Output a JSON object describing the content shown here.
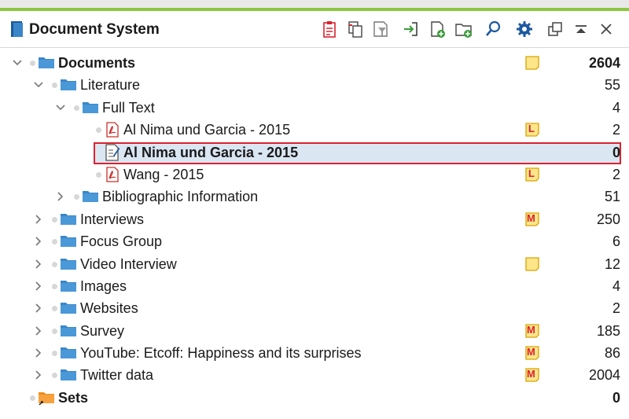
{
  "header": {
    "title": "Document System",
    "icons": [
      "import-documents-icon",
      "copy-documents-icon",
      "filter-icon",
      "import-arrow-icon",
      "new-document-icon",
      "new-folder-icon",
      "search-icon",
      "settings-icon",
      "undock-window-icon",
      "collapse-panel-icon",
      "close-icon"
    ]
  },
  "tree": {
    "root": {
      "label": "Documents",
      "count": "2604"
    },
    "literature": {
      "label": "Literature",
      "count": "55"
    },
    "fulltext": {
      "label": "Full Text",
      "count": "4"
    },
    "doc1": {
      "label": "Al Nima und Garcia - 2015",
      "count": "2",
      "memo": "L"
    },
    "doc2": {
      "label": "Al Nima und Garcia - 2015",
      "count": "0"
    },
    "doc3": {
      "label": "Wang - 2015",
      "count": "2",
      "memo": "L"
    },
    "biblio": {
      "label": "Bibliographic Information",
      "count": "51"
    },
    "interviews": {
      "label": "Interviews",
      "count": "250",
      "memo": "M"
    },
    "focus": {
      "label": "Focus Group",
      "count": "6"
    },
    "video": {
      "label": "Video Interview",
      "count": "12"
    },
    "images": {
      "label": "Images",
      "count": "4"
    },
    "websites": {
      "label": "Websites",
      "count": "2"
    },
    "survey": {
      "label": "Survey",
      "count": "185",
      "memo": "M"
    },
    "youtube": {
      "label": "YouTube: Etcoff: Happiness and its surprises",
      "count": "86",
      "memo": "M"
    },
    "twitter": {
      "label": "Twitter data",
      "count": "2004",
      "memo": "M"
    },
    "sets": {
      "label": "Sets",
      "count": "0"
    }
  },
  "colors": {
    "accent": "#8cc63f",
    "folder": "#3a86c8",
    "selection_border": "#d8232f",
    "selection_fill": "#dbe6f3",
    "memo_fill": "#fde58a",
    "memo_border": "#d9a400",
    "memo_letter": "#d8232f"
  }
}
